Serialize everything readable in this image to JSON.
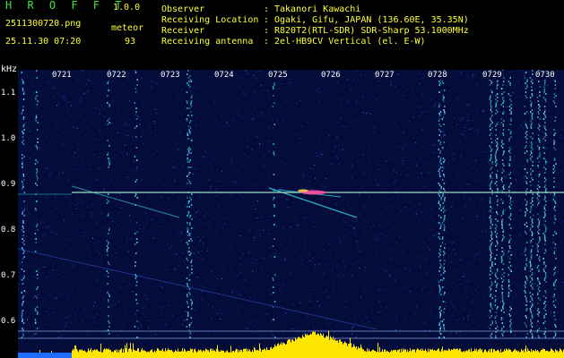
{
  "header": {
    "app_title": "H R O F F T",
    "app_version": "1.0.0",
    "file_name": "2511300720.png",
    "detector_name": "meteor",
    "datetime": "25.11.30 07:20",
    "detection_count": "93",
    "info": [
      {
        "label": "Observer",
        "value": "Takanori Kawachi"
      },
      {
        "label": "Receiving Location",
        "value": "Ogaki, Gifu, JAPAN (136.60E, 35.35N)"
      },
      {
        "label": "Receiver",
        "value": "R820T2(RTL-SDR) SDR-Sharp 53.1000MHz"
      },
      {
        "label": "Receiving antenna",
        "value": "2el-HB9CV Vertical (el. E-W)"
      }
    ],
    "separator": ":"
  },
  "spectrogram": {
    "axis_unit": "kHz",
    "freq_ticks": [
      "1.1",
      "1.0",
      "0.9",
      "0.8",
      "0.7",
      "0.6"
    ],
    "time_ticks": [
      "0721",
      "0722",
      "0723",
      "0724",
      "0725",
      "0726",
      "0727",
      "0728",
      "0729",
      "0730"
    ],
    "colors": {
      "background": "#040c3a",
      "noise": "#2a3ccf",
      "trace": "#2ec7d9",
      "carrier": "#9fe0c8",
      "hot": "#ff4aa0",
      "histogram": "#ffe600",
      "text": "#ffff33",
      "title": "#39e639"
    }
  }
}
